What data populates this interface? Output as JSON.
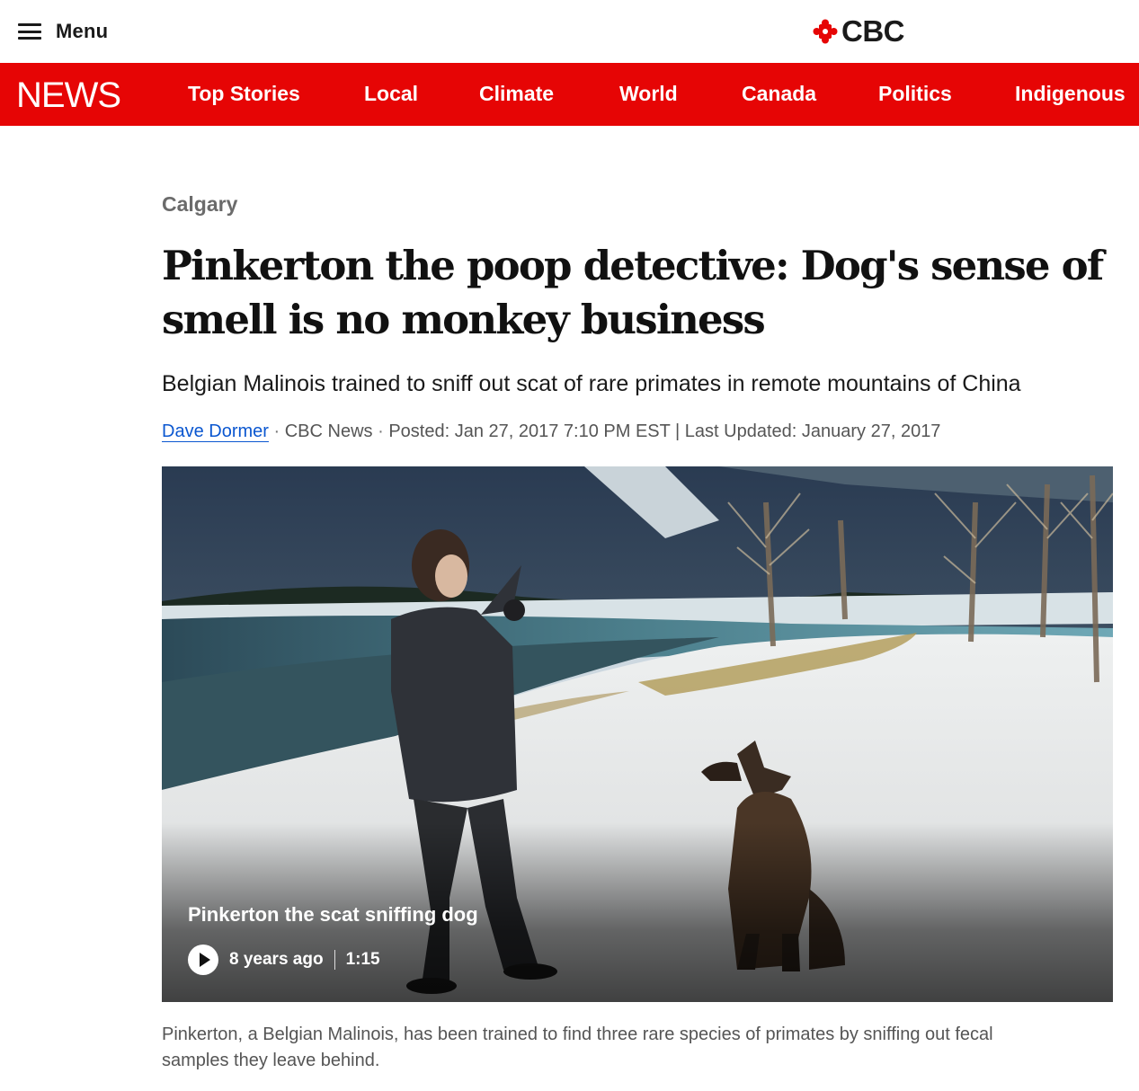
{
  "header": {
    "menu_label": "Menu",
    "logo_text": "CBC",
    "logo_color": "#e60505"
  },
  "nav": {
    "brand": "NEWS",
    "background": "#e60505",
    "items": [
      {
        "label": "Top Stories"
      },
      {
        "label": "Local"
      },
      {
        "label": "Climate"
      },
      {
        "label": "World"
      },
      {
        "label": "Canada"
      },
      {
        "label": "Politics"
      },
      {
        "label": "Indigenous"
      }
    ]
  },
  "article": {
    "section": "Calgary",
    "headline": "Pinkerton the poop detective: Dog's sense of smell is no monkey business",
    "subhead": "Belgian Malinois trained to sniff out scat of rare primates in remote mountains of China",
    "byline": {
      "author": "Dave Dormer",
      "outlet": "CBC News",
      "separator": "·",
      "posted": "Posted: Jan 27, 2017 7:10 PM EST | Last Updated: January 27, 2017"
    },
    "video": {
      "title": "Pinkerton the scat sniffing dog",
      "age": "8 years ago",
      "duration": "1:15"
    },
    "caption": "Pinkerton, a Belgian Malinois, has been trained to find three rare species of primates by sniffing out fecal samples they leave behind."
  }
}
